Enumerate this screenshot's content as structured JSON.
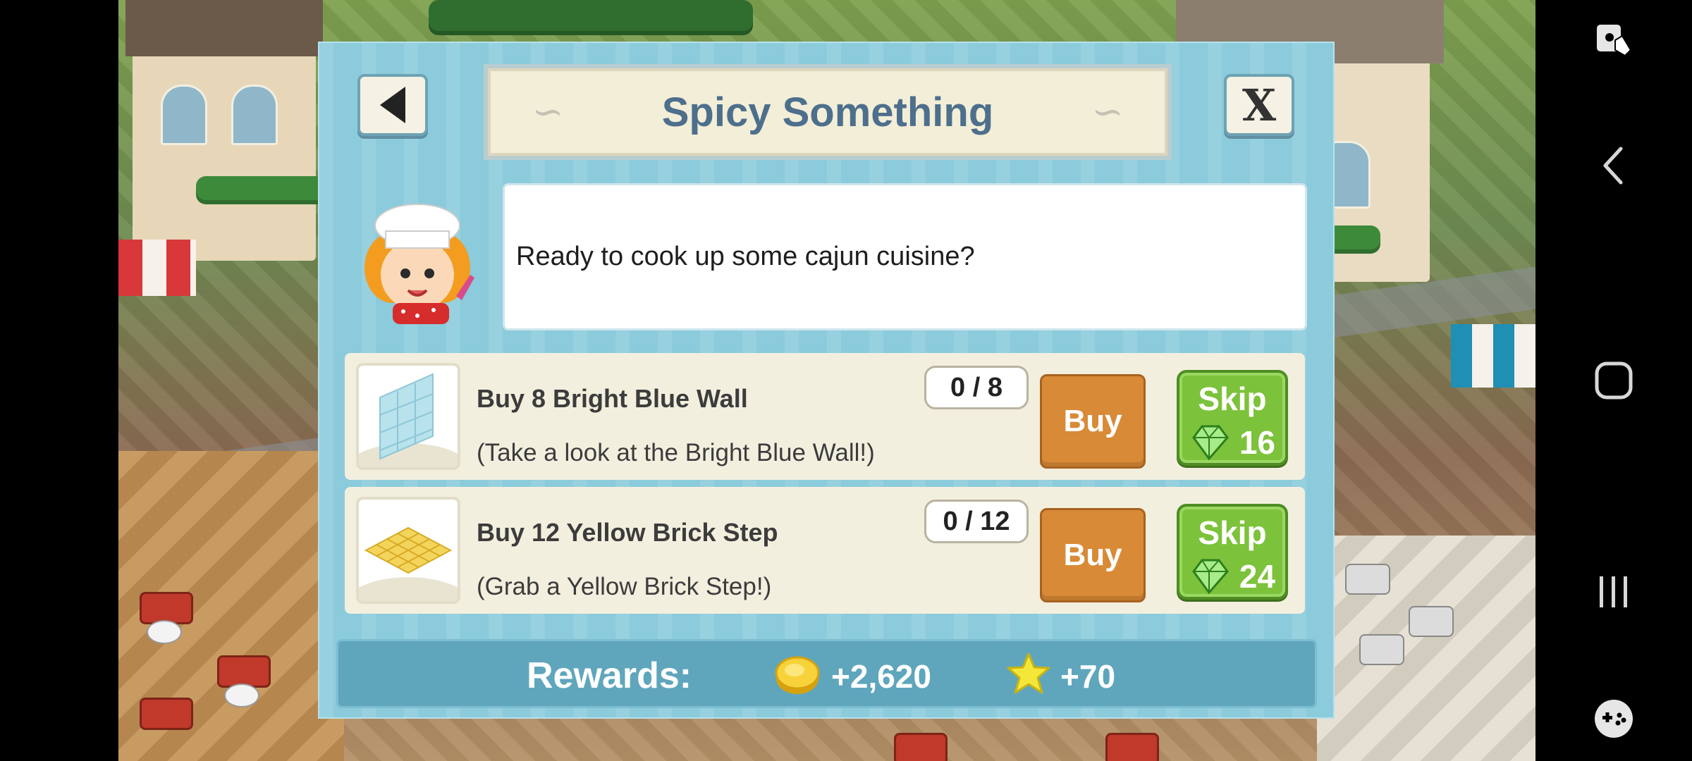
{
  "quest": {
    "title": "Spicy Something",
    "message": "Ready to cook up some cajun cuisine?"
  },
  "close_label": "X",
  "tasks": [
    {
      "title": "Buy 8 Bright Blue Wall",
      "hint": "(Take a look at the Bright Blue Wall!)",
      "progress": "0 / 8",
      "buy_label": "Buy",
      "skip_label": "Skip",
      "skip_cost": "16"
    },
    {
      "title": "Buy 12 Yellow Brick Step",
      "hint": "(Grab a Yellow Brick Step!)",
      "progress": "0 / 12",
      "buy_label": "Buy",
      "skip_label": "Skip",
      "skip_cost": "24"
    }
  ],
  "rewards": {
    "label": "Rewards:",
    "coins": "+2,620",
    "xp": "+70"
  },
  "colors": {
    "dialog_bg": "#8bcbdb",
    "title_text": "#4d6f8c",
    "buy_button": "#d98a36",
    "skip_button": "#7dc23b",
    "rewards_bar": "#5fa6bd"
  },
  "icons": [
    "back-arrow-icon",
    "close-x-icon",
    "chef-avatar",
    "blue-wall-icon",
    "yellow-brick-icon",
    "gem-icon",
    "coin-icon",
    "star-icon",
    "screen-recorder-icon",
    "nav-back-icon",
    "nav-home-icon",
    "nav-recents-icon",
    "game-launcher-icon"
  ]
}
